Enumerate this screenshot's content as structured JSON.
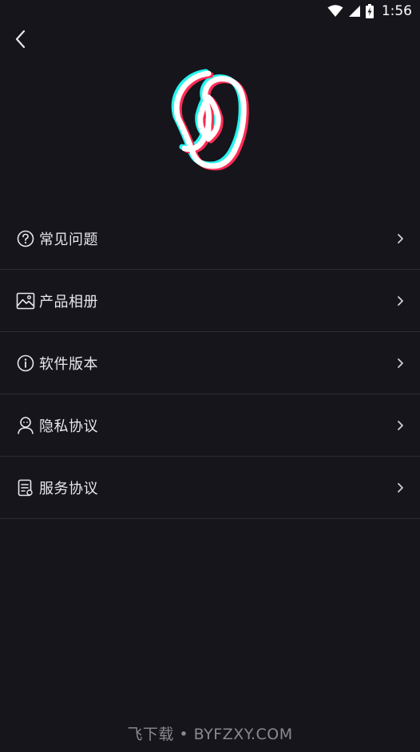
{
  "status_bar": {
    "time": "1:56",
    "icons": [
      "wifi-icon",
      "signal-icon",
      "battery-charging-icon"
    ]
  },
  "header": {
    "back_icon": "chevron-left-icon"
  },
  "logo": {
    "icon": "app-logo-icon"
  },
  "menu": {
    "items": [
      {
        "label": "常见问题",
        "icon": "question-circle-icon"
      },
      {
        "label": "产品相册",
        "icon": "image-icon"
      },
      {
        "label": "软件版本",
        "icon": "info-circle-icon"
      },
      {
        "label": "隐私协议",
        "icon": "user-icon"
      },
      {
        "label": "服务协议",
        "icon": "document-icon"
      }
    ]
  },
  "watermark": {
    "text": "飞下载 • BYFZXY.COM"
  },
  "colors": {
    "background": "#16151b",
    "divider": "#2e2d33",
    "text": "#e8e8ec",
    "logo_cyan": "#25f4ee",
    "logo_red": "#fe2c55"
  }
}
